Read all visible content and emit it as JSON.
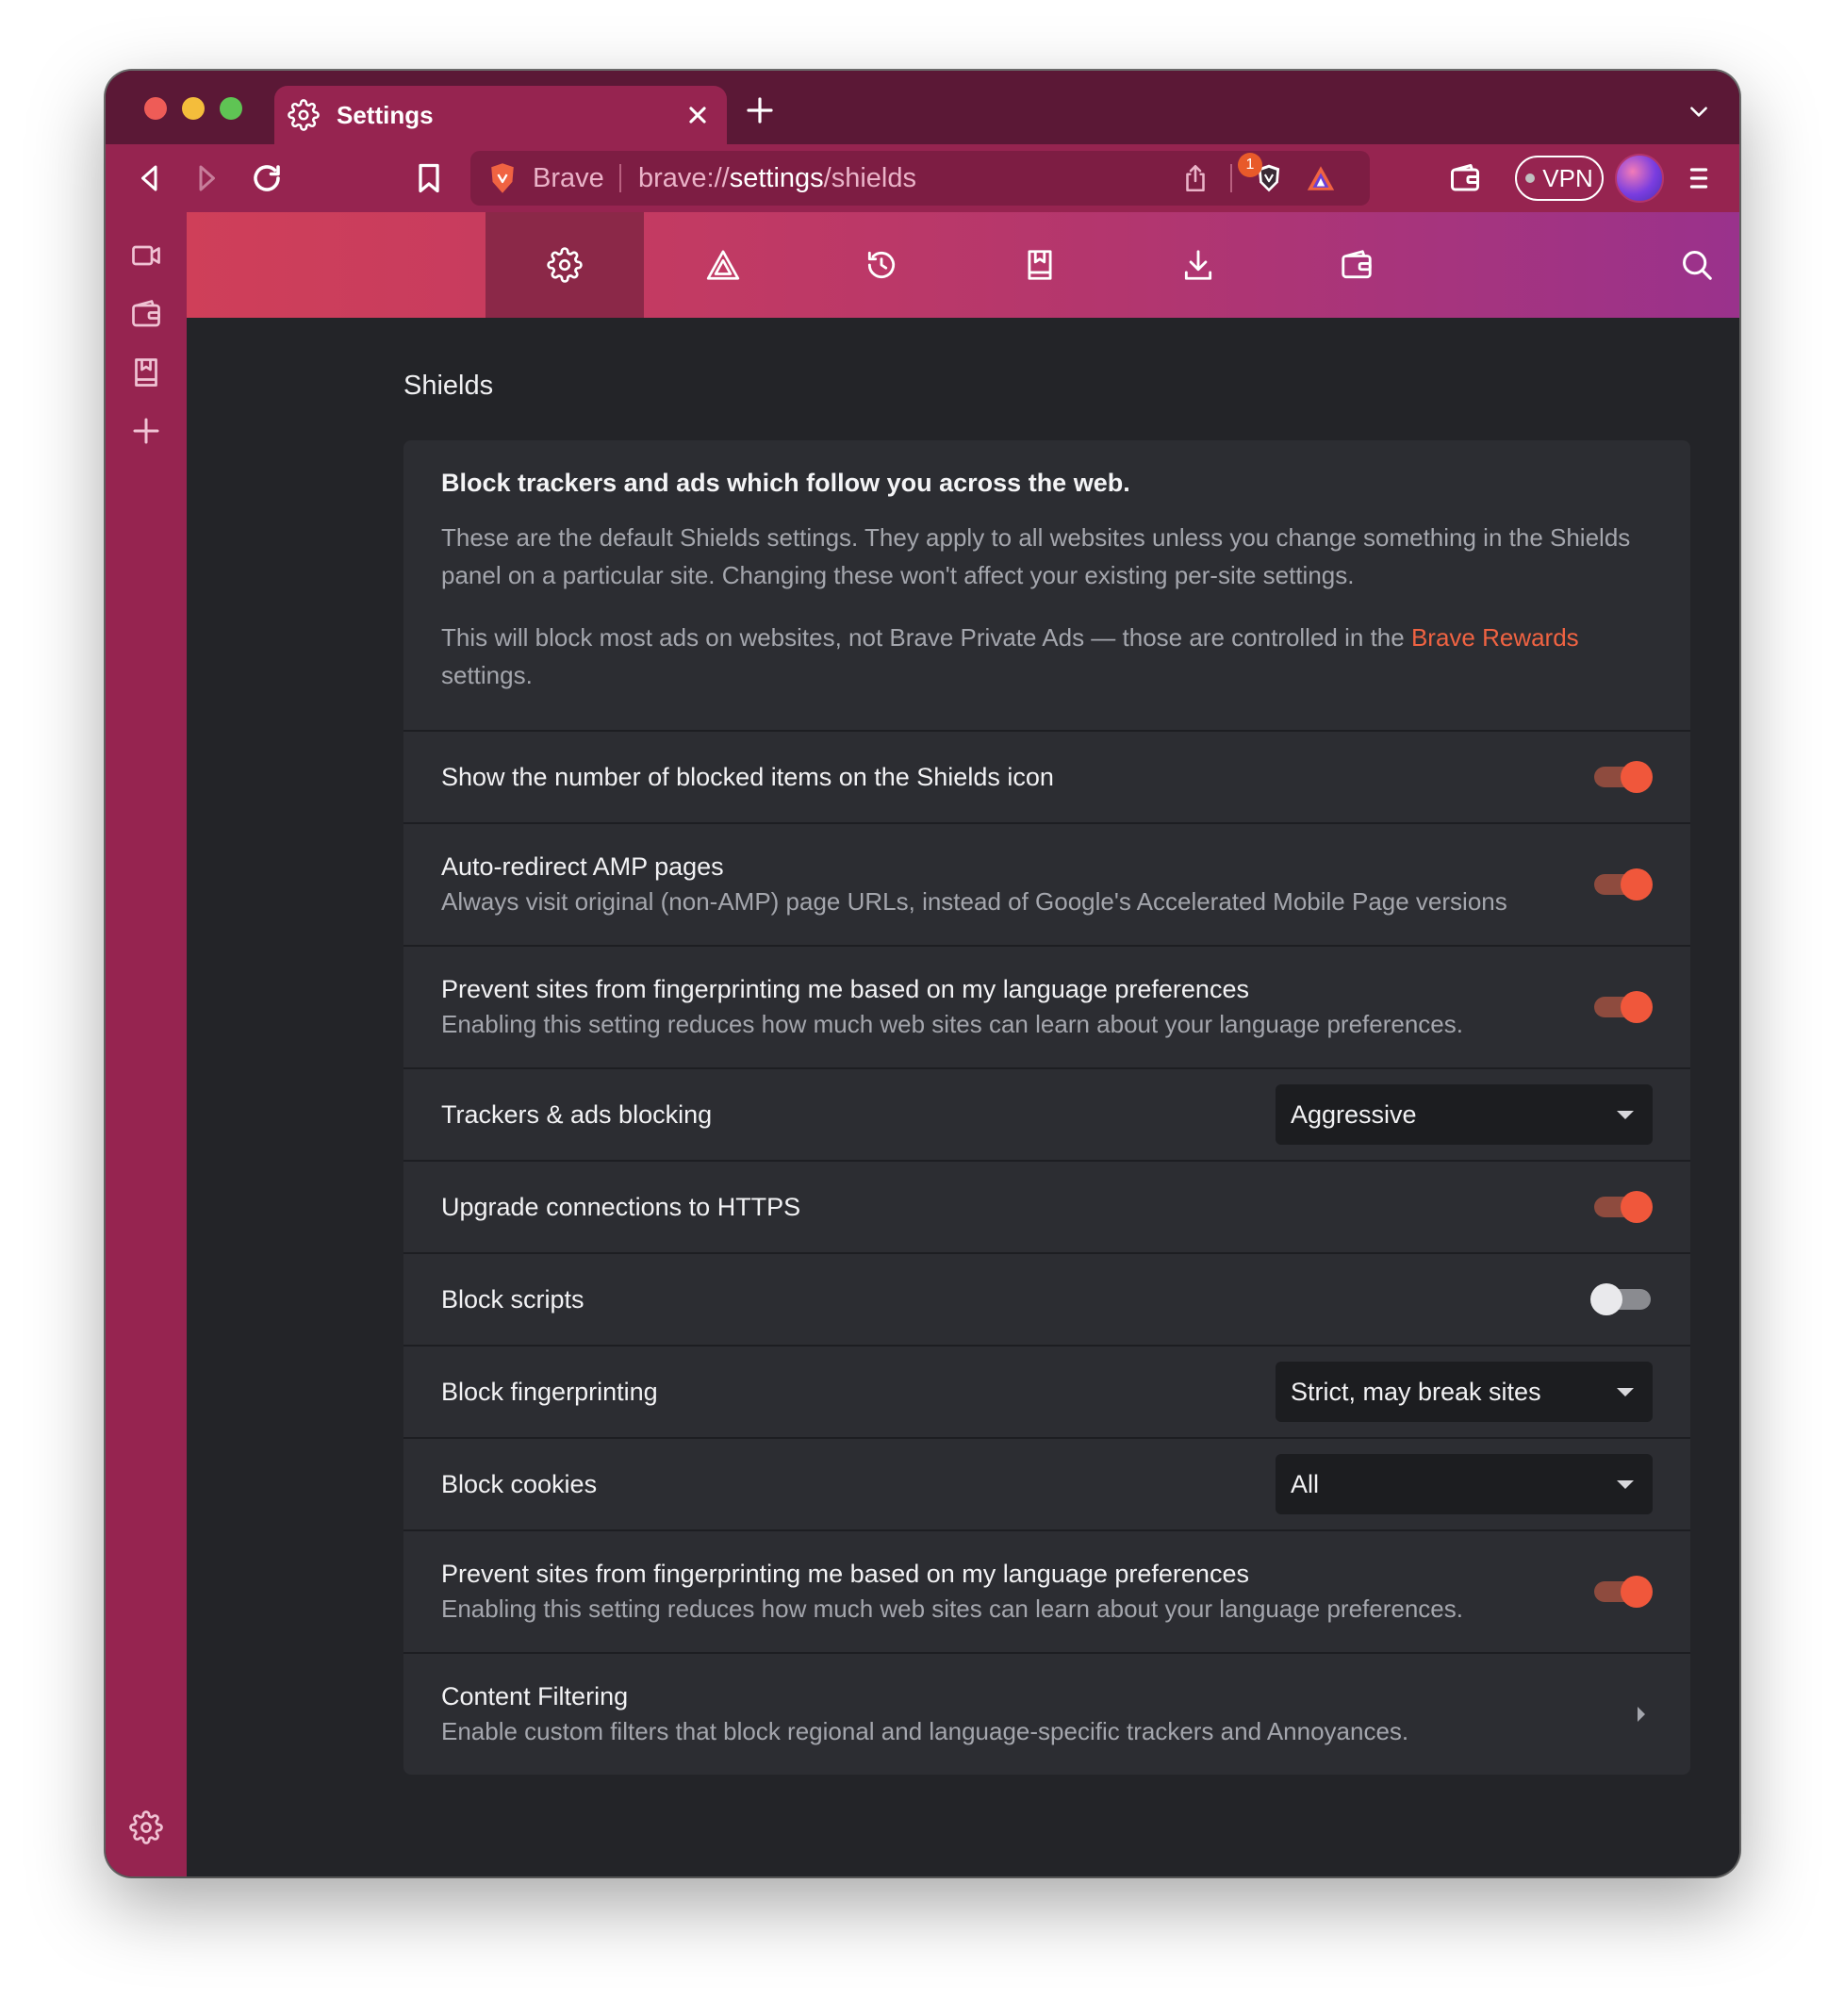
{
  "tab": {
    "title": "Settings"
  },
  "omnibox": {
    "brand": "Brave",
    "url_scheme": "brave://",
    "url_host": "settings",
    "url_path": "/shields"
  },
  "rewards_badge": "1",
  "vpn_label": "VPN",
  "page": {
    "section_title": "Shields",
    "intro": {
      "heading": "Block trackers and ads which follow you across the web.",
      "p1": "These are the default Shields settings. They apply to all websites unless you change something in the Shields panel on a particular site. Changing these won't affect your existing per-site settings.",
      "p2_before": "This will block most ads on websites, not Brave Private Ads — those are controlled in the ",
      "p2_link": "Brave Rewards",
      "p2_after": " settings."
    },
    "settings": {
      "show_count": {
        "title": "Show the number of blocked items on the Shields icon",
        "enabled": true
      },
      "amp": {
        "title": "Auto-redirect AMP pages",
        "sub": "Always visit original (non-AMP) page URLs, instead of Google's Accelerated Mobile Page versions",
        "enabled": true
      },
      "lang_fp_1": {
        "title": "Prevent sites from fingerprinting me based on my language preferences",
        "sub": "Enabling this setting reduces how much web sites can learn about your language preferences.",
        "enabled": true
      },
      "trackers": {
        "title": "Trackers & ads blocking",
        "value": "Aggressive"
      },
      "https": {
        "title": "Upgrade connections to HTTPS",
        "enabled": true
      },
      "scripts": {
        "title": "Block scripts",
        "enabled": false
      },
      "fingerprinting": {
        "title": "Block fingerprinting",
        "value": "Strict, may break sites"
      },
      "cookies": {
        "title": "Block cookies",
        "value": "All"
      },
      "lang_fp_2": {
        "title": "Prevent sites from fingerprinting me based on my language preferences",
        "sub": "Enabling this setting reduces how much web sites can learn about your language preferences.",
        "enabled": true
      },
      "content_filtering": {
        "title": "Content Filtering",
        "sub": "Enable custom filters that block regional and language-specific trackers and Annoyances."
      }
    }
  },
  "colors": {
    "titlebar": "#5b1836",
    "toolbar": "#962450",
    "accent": "#f0573b",
    "link": "#f06342",
    "content_bg": "#232428",
    "card_bg": "#2c2d32"
  }
}
